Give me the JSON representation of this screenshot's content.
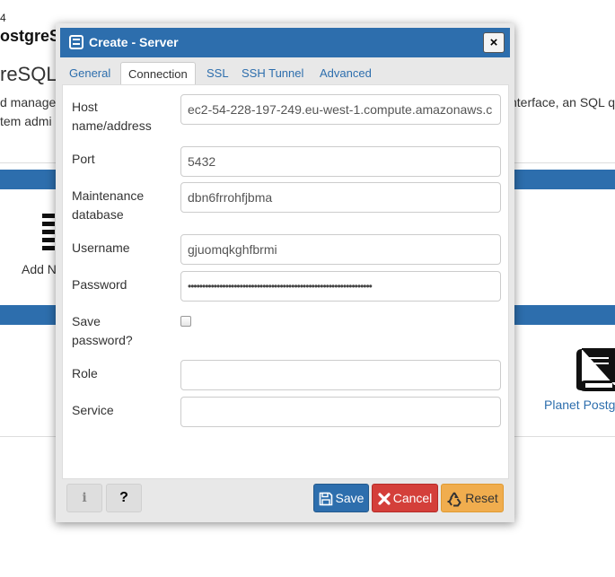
{
  "background": {
    "version_fragment": "4",
    "title_fragment": "ostgreS",
    "heading_fragment": "reSQL",
    "desc_line1": "d manage",
    "desc_line2": "tem admi",
    "desc_right": "nterface, an SQL q",
    "add_server_fragment": "Add N",
    "planet_link": "Planet Postgr"
  },
  "dialog": {
    "title": "Create - Server",
    "close_label": "×",
    "tabs": [
      {
        "label": "General"
      },
      {
        "label": "Connection"
      },
      {
        "label": "SSL"
      },
      {
        "label": "SSH Tunnel"
      },
      {
        "label": "Advanced"
      }
    ],
    "active_tab": "Connection",
    "fields": {
      "host": {
        "label_line1": "Host",
        "label_line2": "name/address",
        "value": "ec2-54-228-197-249.eu-west-1.compute.amazonaws.c"
      },
      "port": {
        "label": "Port",
        "value": "5432"
      },
      "maintenance_db": {
        "label_line1": "Maintenance",
        "label_line2": "database",
        "value": "dbn6frrohfjbma"
      },
      "username": {
        "label": "Username",
        "value": "gjuomqkghfbrmi"
      },
      "password": {
        "label": "Password",
        "value": "••••••••••••••••••••••••••••••••••••••••••••••••••••••••••••••••"
      },
      "save_password": {
        "label_line1": "Save",
        "label_line2": "password?",
        "checked": false
      },
      "role": {
        "label": "Role",
        "value": ""
      },
      "service": {
        "label": "Service",
        "value": ""
      }
    },
    "footer": {
      "info_label": "i",
      "help_label": "?",
      "save_label": "Save",
      "cancel_label": "Cancel",
      "reset_label": "Reset"
    }
  },
  "colors": {
    "primary": "#2d6ead",
    "danger": "#d43f3a",
    "warning": "#f0ad4e"
  },
  "icons": [
    "server-icon",
    "close-icon",
    "info-icon",
    "help-icon",
    "save-icon",
    "cancel-icon",
    "reset-icon",
    "add-server-icon",
    "book-icon"
  ]
}
